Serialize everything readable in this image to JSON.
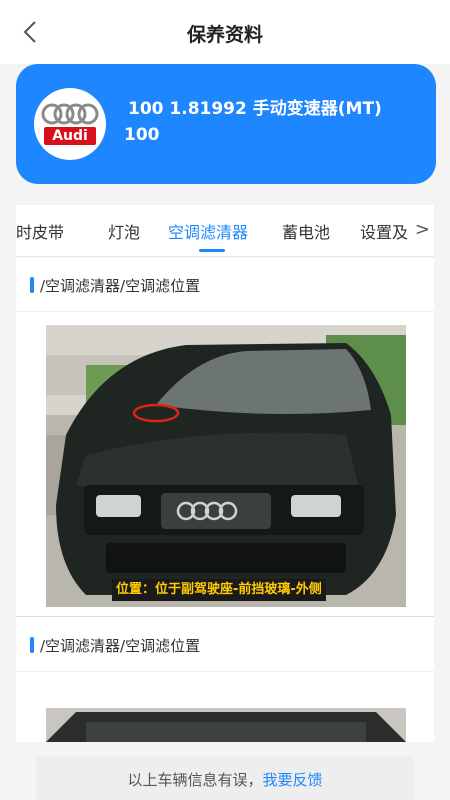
{
  "header": {
    "title": "保养资料",
    "back_icon": "chevron-left-icon"
  },
  "car": {
    "logo_text": "Audi",
    "name_line1": "100 1.81992 手动变速器(MT)",
    "name_line2": "100"
  },
  "tabs": {
    "items": [
      {
        "label": "正时皮带"
      },
      {
        "label": "灯泡"
      },
      {
        "label": "空调滤清器"
      },
      {
        "label": "蓄电池"
      },
      {
        "label": "设置及"
      }
    ],
    "active": "空调滤清器",
    "more_icon": "chevron-right-icon",
    "more_label": ">"
  },
  "sections": [
    {
      "title": "/空调滤清器/空调滤位置",
      "caption": "位置：位于副驾驶座-前挡玻璃-外侧"
    },
    {
      "title": "/空调滤清器/空调滤位置"
    }
  ],
  "footer": {
    "text": "以上车辆信息有误，",
    "link": "我要反馈"
  },
  "colors": {
    "accent": "#1e86ff",
    "caption_text": "#ffcc00"
  }
}
